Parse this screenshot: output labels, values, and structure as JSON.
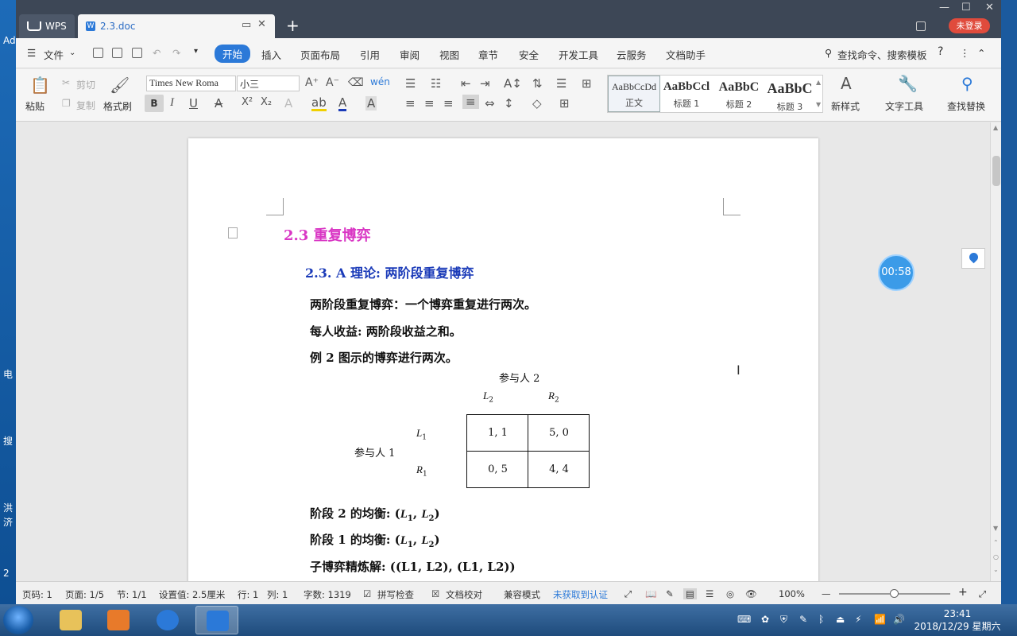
{
  "desktop": {
    "left_labels": [
      "Ad",
      "电",
      "搜",
      "洪",
      "济",
      "2"
    ]
  },
  "titlebar": {
    "tabs": [
      {
        "label": "WPS"
      },
      {
        "label": "2.3.doc"
      }
    ],
    "login_label": "未登录"
  },
  "menu": {
    "file_label": "文件",
    "items": [
      "开始",
      "插入",
      "页面布局",
      "引用",
      "审阅",
      "视图",
      "章节",
      "安全",
      "开发工具",
      "云服务",
      "文档助手"
    ],
    "active": "开始",
    "search_label": "查找命令、搜索模板",
    "help_label": "?"
  },
  "ribbon": {
    "paste": "粘贴",
    "cut": "剪切",
    "copy": "复制",
    "format_painter": "格式刷",
    "font_name": "Times New Roma",
    "font_size": "小三",
    "styles": [
      {
        "preview": "AaBbCcDd",
        "name": "正文"
      },
      {
        "preview": "AaBbCcl",
        "name": "标题 1"
      },
      {
        "preview": "AaBbC",
        "name": "标题 2"
      },
      {
        "preview": "AaBbC",
        "name": "标题 3"
      }
    ],
    "new_style": "新样式",
    "text_tools": "文字工具",
    "find_replace": "查找替换"
  },
  "timer": "00:58",
  "document": {
    "heading1": "2.3  重复博弈",
    "heading2": "2.3. A 理论:  两阶段重复博弈",
    "paragraphs": [
      "两阶段重复博弈：一个博弈重复进行两次。",
      "每人收益: 两阶段收益之和。",
      "例 2 图示的博弈进行两次。"
    ],
    "game": {
      "player2": "参与人 2",
      "player1": "参与人  1",
      "col_labels": [
        "L",
        "R"
      ],
      "col_subs": [
        "2",
        "2"
      ],
      "row_labels": [
        "L",
        "R"
      ],
      "row_subs": [
        "1",
        "1"
      ],
      "payoffs": [
        [
          "1,  1",
          "5,  0"
        ],
        [
          "0,  5",
          "4,  4"
        ]
      ]
    },
    "eq_lines": [
      {
        "prefix": "阶段  2  的均衡: (",
        "a": "L",
        "as": "1",
        "b": "L",
        "bs": "2",
        "suffix": ")"
      },
      {
        "prefix": "阶段  1  的均衡: (",
        "a": "L",
        "as": "1",
        "b": "L",
        "bs": "2",
        "suffix": ")"
      }
    ],
    "spe": "子博弈精炼解: ((L1, L2), (L1, L2))"
  },
  "status": {
    "page_code": "页码: 1",
    "page": "页面: 1/5",
    "section": "节: 1/1",
    "setting": "设置值: 2.5厘米",
    "row": "行: 1",
    "col": "列: 1",
    "words": "字数: 1319",
    "spell": "拼写检查",
    "proof": "文档校对",
    "compat": "兼容模式",
    "auth": "未获取到认证",
    "zoom": "100%"
  },
  "taskbar": {
    "time": "23:41",
    "date": "2018/12/29 星期六"
  }
}
